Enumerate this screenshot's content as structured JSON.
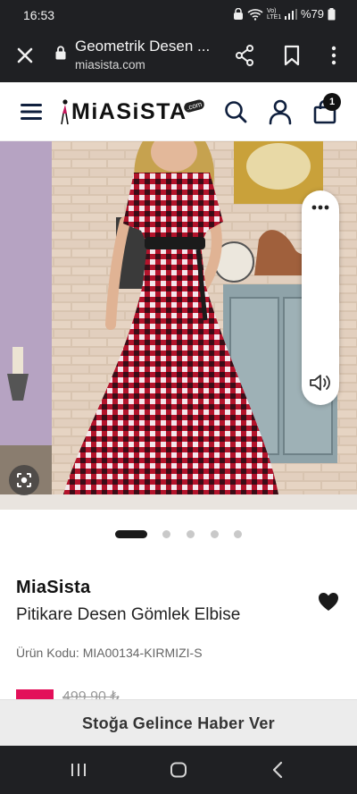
{
  "status_bar": {
    "time": "16:53",
    "network": "Vo) LTE1",
    "battery": "%79"
  },
  "browser": {
    "page_title": "Geometrik Desen ...",
    "url": "miasista.com",
    "icons": [
      "close-icon",
      "lock-icon",
      "share-icon",
      "bookmark-icon",
      "more-vertical-icon"
    ]
  },
  "site_header": {
    "logo": "MiASiSTA",
    "logo_suffix": ".com",
    "cart_count": "1",
    "icons": [
      "menu-icon",
      "search-icon",
      "account-icon",
      "cart-icon"
    ]
  },
  "carousel": {
    "slide_count": 5,
    "active_index": 0
  },
  "product": {
    "brand": "MiaSista",
    "name": "Pitikare Desen Gömlek Elbise",
    "code_label": "Ürün Kodu:",
    "code_value": "MIA00134-KIRMIZI-S",
    "old_price": "499,90 ₺",
    "discount_color": "#e3105a"
  },
  "notify_button": {
    "label": "Stoğa Gelince Haber Ver"
  },
  "colors": {
    "chrome_bg": "#1f2023",
    "dress_red": "#b3132b",
    "accent_pink": "#e3105a",
    "notify_bg": "#ececec"
  }
}
